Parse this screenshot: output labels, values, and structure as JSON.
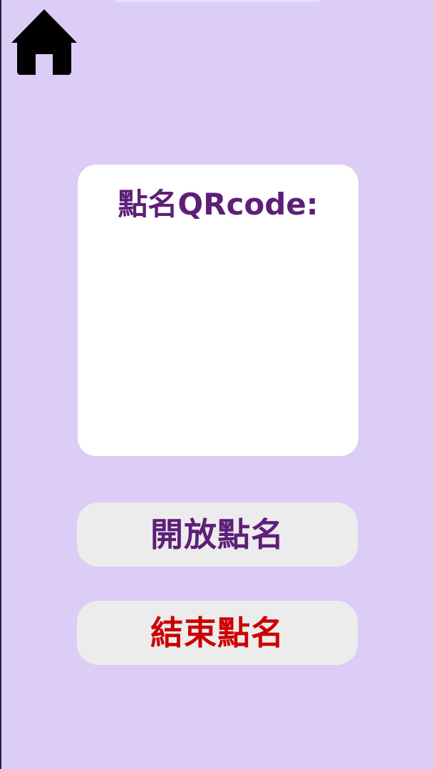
{
  "header": {
    "home_icon": "home-icon"
  },
  "qr_card": {
    "title": "點名QRcode:"
  },
  "actions": {
    "open_label": "開放點名",
    "close_label": "結束點名"
  },
  "colors": {
    "background": "#dccdf7",
    "card": "#ffffff",
    "button_bg": "#ececec",
    "title_purple": "#5e1f79",
    "close_red": "#cc0000"
  }
}
